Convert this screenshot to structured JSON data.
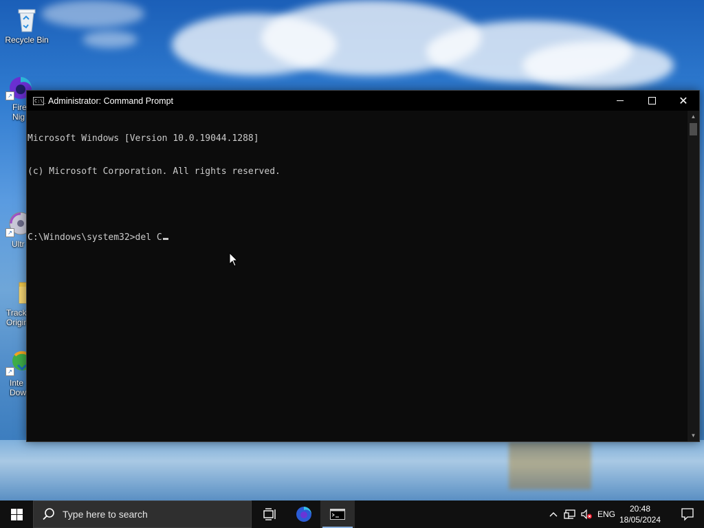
{
  "desktop": {
    "icons": [
      {
        "label": "Recycle Bin",
        "icon": "recycle-bin-icon"
      },
      {
        "label": "Fire\nNig",
        "icon": "firefox-nightly-icon"
      },
      {
        "label": "Ultr",
        "icon": "ultraiso-icon"
      },
      {
        "label": "Track\nOrigin",
        "icon": "folder-icon"
      },
      {
        "label": "Inte\nDow",
        "icon": "internet-download-manager-icon"
      }
    ]
  },
  "window": {
    "title": "Administrator: Command Prompt",
    "app_icon_text": "C:\\_",
    "console_lines": [
      "Microsoft Windows [Version 10.0.19044.1288]",
      "(c) Microsoft Corporation. All rights reserved.",
      "",
      "C:\\Windows\\system32>del C"
    ]
  },
  "taskbar": {
    "search_placeholder": "Type here to search",
    "language": "ENG",
    "time": "20:48",
    "date": "18/05/2024",
    "apps": [
      "task-view-icon",
      "firefox-icon",
      "command-prompt-icon"
    ]
  },
  "colors": {
    "console_bg": "#0c0c0c",
    "console_text": "#cccccc",
    "taskbar_bg": "#101010",
    "active_indicator": "#8db4e2"
  }
}
